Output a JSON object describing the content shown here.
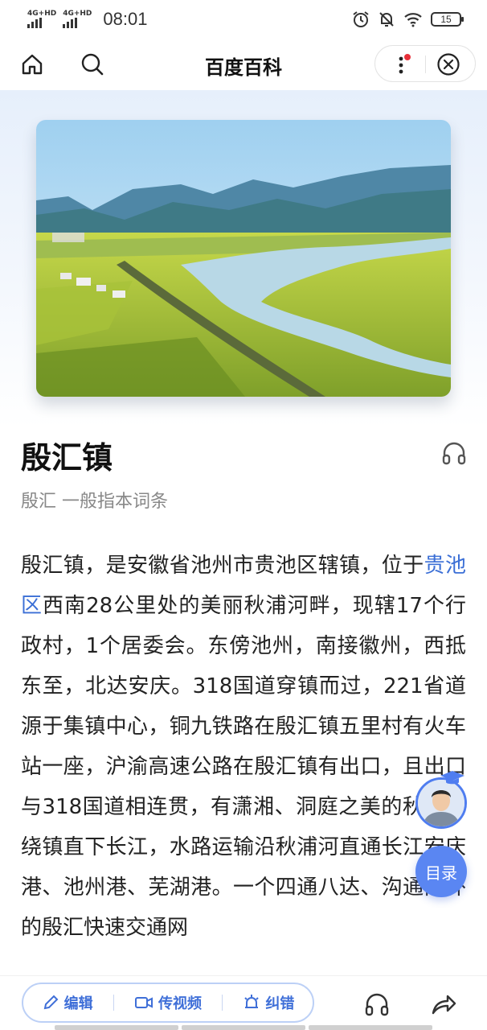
{
  "status_bar": {
    "signal_1": "4G+HD",
    "signal_2": "4G+HD",
    "time": "08:01",
    "battery": "15"
  },
  "nav": {
    "title": "百度百科"
  },
  "article": {
    "title": "殷汇镇",
    "subtitle": "殷汇 一般指本词条",
    "body_before_link": "殷汇镇，是安徽省池州市贵池区辖镇，位于",
    "body_link": "贵池区",
    "body_after_link": "西南28公里处的美丽秋浦河畔，现辖17个行政村，1个居委会。东傍池州，南接徽州，西抵东至，北达安庆。318国道穿镇而过，221省道源于集镇中心，铜九铁路在殷汇镇五里村有火车站一座，沪渝高速公路在殷汇镇有出口，且出口与318国道相连贯，有潇湘、洞庭之美的秋浦河绕镇直下长江，水路运输沿秋浦河直通长江安庆港、池州港、芜湖港。一个四通八达、沟通内外的殷汇快速交通网"
  },
  "floating": {
    "toc_label": "目录"
  },
  "bottom_bar": {
    "edit_label": "编辑",
    "video_label": "传视频",
    "correct_label": "纠错"
  },
  "colors": {
    "accent": "#3f6fd8",
    "link": "#3b6fd6",
    "toc_button": "#5a86f2",
    "notification_dot": "#e8303a"
  }
}
